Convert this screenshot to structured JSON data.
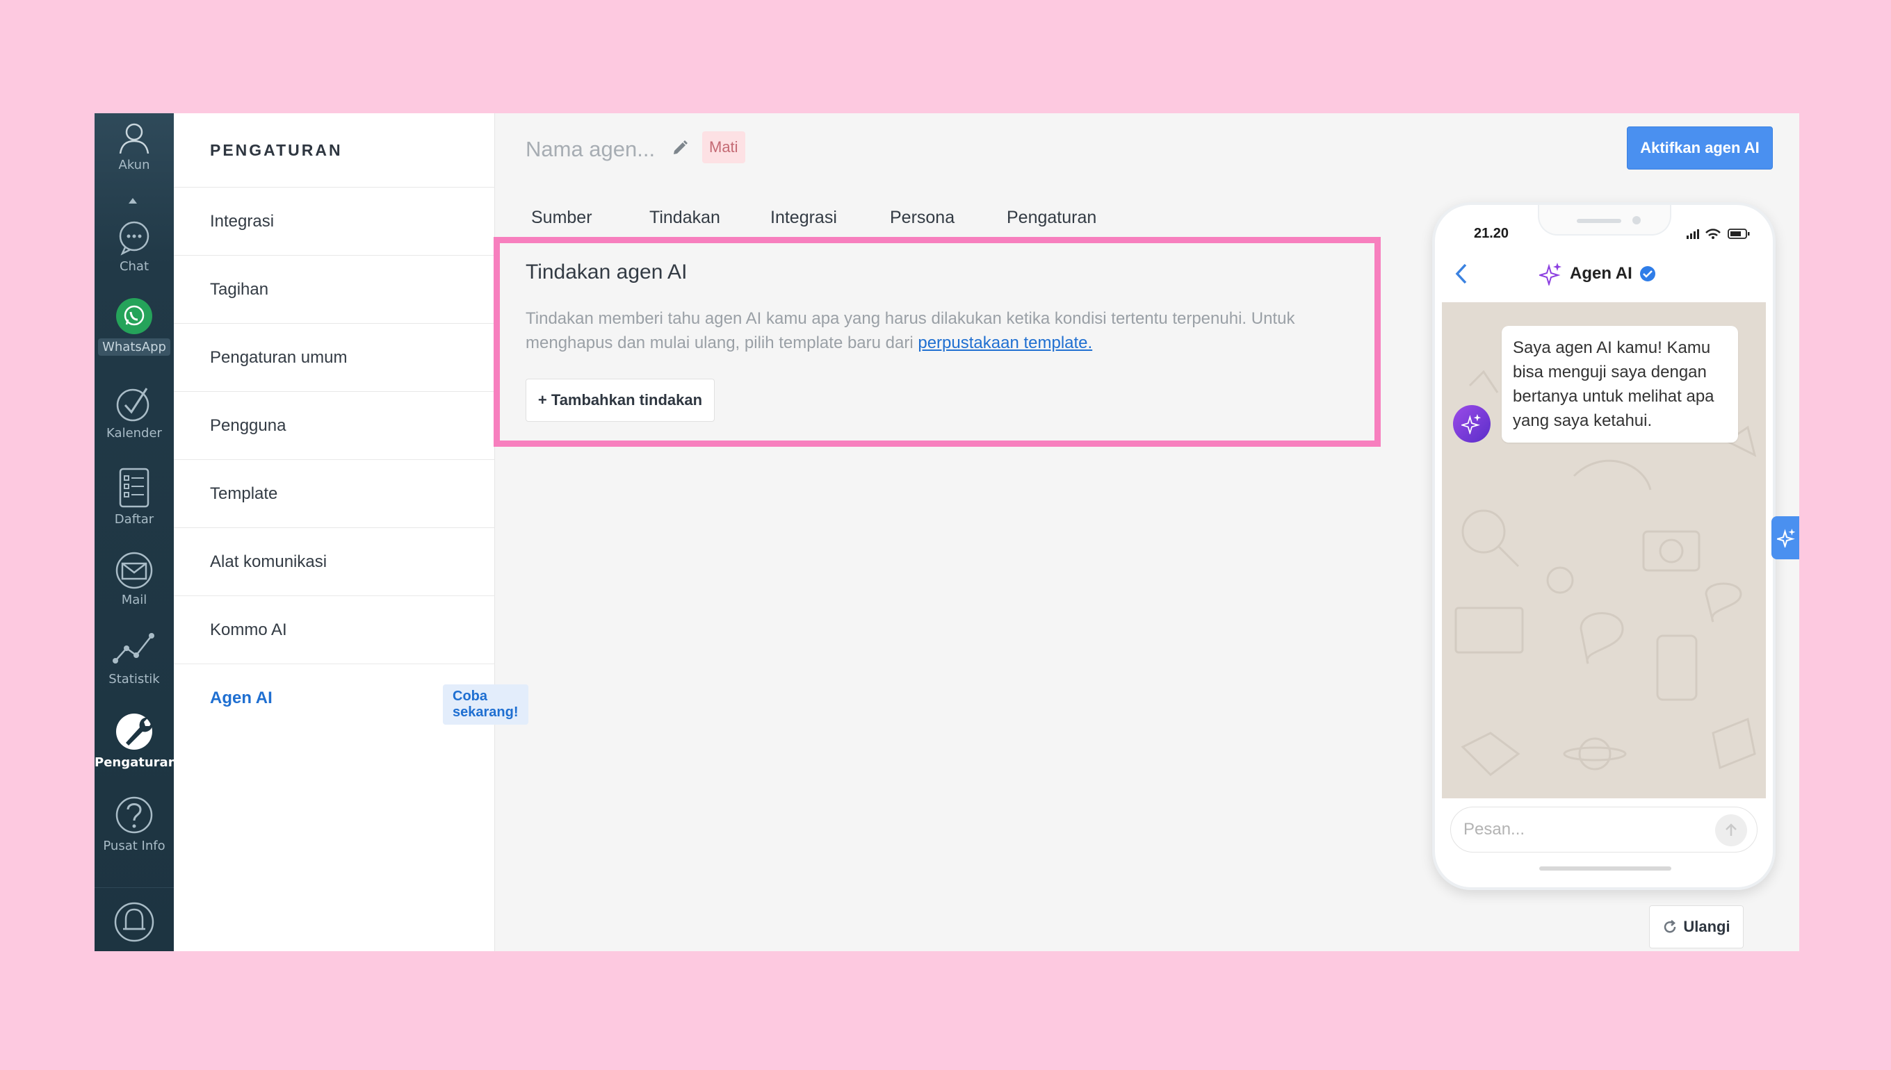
{
  "nav": {
    "items": [
      {
        "label": "Akun",
        "icon": "user-icon"
      },
      {
        "label": "Chat",
        "icon": "chat-icon"
      },
      {
        "label": "WhatsApp",
        "icon": "whatsapp-icon"
      },
      {
        "label": "Kalender",
        "icon": "checkmark-icon"
      },
      {
        "label": "Daftar",
        "icon": "list-icon"
      },
      {
        "label": "Mail",
        "icon": "mail-icon"
      },
      {
        "label": "Statistik",
        "icon": "chart-icon"
      },
      {
        "label": "Pengaturan",
        "icon": "wrench-icon"
      },
      {
        "label": "Pusat Info",
        "icon": "question-icon"
      }
    ],
    "active": "Pengaturan",
    "bell_icon": "bell-icon"
  },
  "settings": {
    "title": "PENGATURAN",
    "items": [
      {
        "label": "Integrasi"
      },
      {
        "label": "Tagihan"
      },
      {
        "label": "Pengaturan umum"
      },
      {
        "label": "Pengguna"
      },
      {
        "label": "Template"
      },
      {
        "label": "Alat komunikasi"
      },
      {
        "label": "Kommo AI"
      },
      {
        "label": "Agen AI"
      }
    ],
    "active": "Agen AI",
    "try_badge": "Coba sekarang!"
  },
  "main": {
    "agent_name_placeholder": "Nama agen...",
    "status": "Mati",
    "activate_button": "Aktifkan agen AI",
    "tabs": [
      {
        "label": "Sumber"
      },
      {
        "label": "Tindakan"
      },
      {
        "label": "Integrasi"
      },
      {
        "label": "Persona"
      },
      {
        "label": "Pengaturan"
      }
    ],
    "actions": {
      "title": "Tindakan agen AI",
      "description": "Tindakan memberi tahu agen AI kamu apa yang harus dilakukan ketika kondisi tertentu terpenuhi. Untuk menghapus dan mulai ulang, pilih template baru dari ",
      "link": "perpustakaan template.",
      "add_button": "+ Tambahkan tindakan"
    }
  },
  "phone": {
    "time": "21.20",
    "header_title": "Agen AI",
    "message": "Saya agen AI kamu! Kamu bisa menguji saya dengan bertanya untuk melihat apa yang saya ketahui.",
    "input_placeholder": "Pesan...",
    "reset_button": "Ulangi"
  },
  "colors": {
    "accent": "#4a90f0",
    "highlight_border": "#f77fbe",
    "background": "#fdc9e0",
    "nav_bg": "#1d3441",
    "status_bg": "#fde1e4",
    "whatsapp": "#25a35a"
  }
}
